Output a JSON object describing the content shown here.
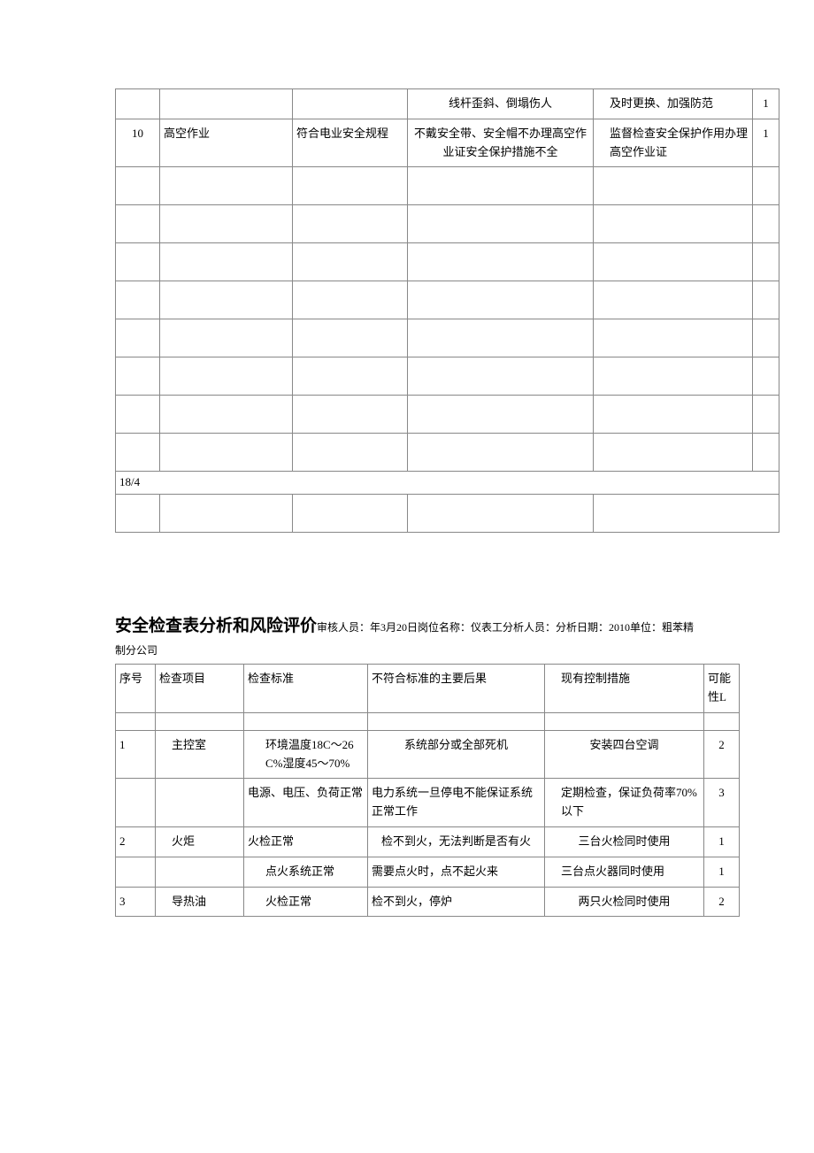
{
  "table1": {
    "rows": [
      {
        "seq": "",
        "item": "",
        "std": "",
        "cons": "线杆歪斜、倒塌伤人",
        "ctrl": "及时更换、加强防范",
        "val": "1"
      },
      {
        "seq": "10",
        "item": "高空作业",
        "std": "符合电业安全规程",
        "cons": "不戴安全带、安全帽不办理高空作业证安全保护措施不全",
        "ctrl": "监督检查安全保护作用办理高空作业证",
        "val": "1"
      }
    ],
    "page_marker": "18/4"
  },
  "section2": {
    "title": "安全检查表分析和风险评价",
    "meta": "审核人员：年3月20日岗位名称：仪表工分析人员：分析日期：2010单位：粗苯精制分公司",
    "headers": {
      "seq": "序号",
      "item": "检查项目",
      "std": "检查标准",
      "cons": "不符合标准的主要后果",
      "ctrl": "现有控制措施",
      "val": "可能性L"
    },
    "rows": [
      {
        "seq": "1",
        "item": "主控室",
        "std": "环境温度18C～26C%湿度45～70%",
        "cons": "系统部分或全部死机",
        "ctrl": "安装四台空调",
        "val": "2"
      },
      {
        "seq": "",
        "item": "",
        "std": "电源、电压、负荷正常",
        "cons": "电力系统一旦停电不能保证系统正常工作",
        "ctrl": "定期检查，保证负荷率70%以下",
        "val": "3"
      },
      {
        "seq": "2",
        "item": "火炬",
        "std": "火检正常",
        "cons": "检不到火，无法判断是否有火",
        "ctrl": "三台火检同时使用",
        "val": "1"
      },
      {
        "seq": "",
        "item": "",
        "std": "点火系统正常",
        "cons": "需要点火时，点不起火来",
        "ctrl": "三台点火器同时使用",
        "val": "1"
      },
      {
        "seq": "3",
        "item": "导热油",
        "std": "火检正常",
        "cons": "检不到火，停炉",
        "ctrl": "两只火检同时使用",
        "val": "2"
      }
    ]
  }
}
